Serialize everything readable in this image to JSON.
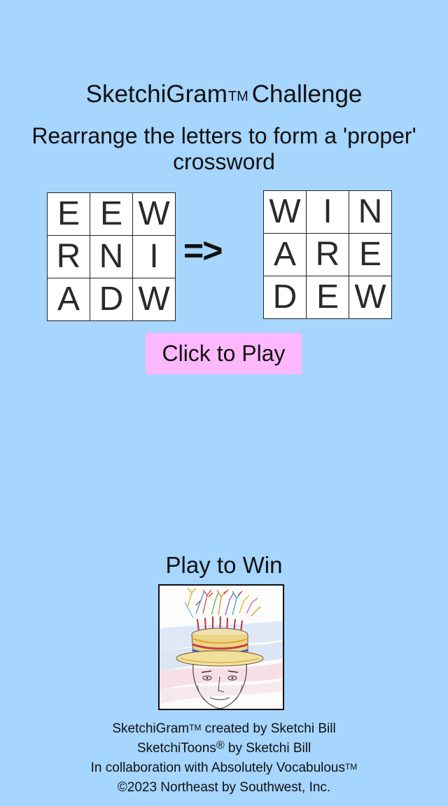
{
  "header": {
    "title": "SketchiGram",
    "title_mark": "TM",
    "title_suffix": "Challenge",
    "instructions": "Rearrange the letters to form a 'proper' crossword"
  },
  "example": {
    "scrambled": [
      "E",
      "E",
      "W",
      "R",
      "N",
      "I",
      "A",
      "D",
      "W"
    ],
    "arrow": "=>",
    "solved": [
      "W",
      "I",
      "N",
      "A",
      "R",
      "E",
      "D",
      "E",
      "W"
    ]
  },
  "play_button": {
    "label": "Click to Play",
    "color": "#fcb7fd"
  },
  "promo": {
    "label": "Play to Win"
  },
  "credits": {
    "line1_name": "SketchiGram",
    "line1_mark": "TM",
    "line1_rest": " created by Sketchi Bill",
    "line2_name": "SketchiToons",
    "line2_mark": "®",
    "line2_rest": " by Sketchi Bill",
    "line3_text": "In collaboration with Absolutely Vocabulous",
    "line3_mark": "TM",
    "line4_text": "©2023 Northeast by Southwest, Inc."
  },
  "colors": {
    "background": "#a6d5fd",
    "tile": "#ffffff",
    "button": "#fcb7fd"
  }
}
